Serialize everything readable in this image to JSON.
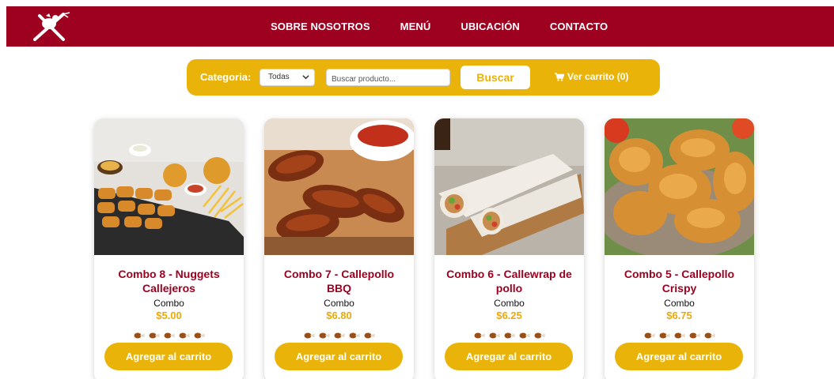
{
  "colors": {
    "brand": "#9e0020",
    "accent": "#e9b30a",
    "price": "#e9a90a"
  },
  "navbar": {
    "logo_icon": "chicken-fork-knife-logo-icon",
    "links": [
      "SOBRE NOSOTROS",
      "MENÚ",
      "UBICACIÓN",
      "CONTACTO"
    ]
  },
  "filters": {
    "category_label": "Categoria:",
    "category_selected": "Todas",
    "search_placeholder": "Buscar producto...",
    "search_button": "Buscar",
    "cart_icon": "cart-icon",
    "cart_label": "Ver carrito (0)"
  },
  "products": [
    {
      "title": "Combo 8 - Nuggets Callejeros",
      "category": "Combo",
      "price": "$5.00",
      "rating": 5,
      "button": "Agregar al carrito"
    },
    {
      "title": "Combo 7 - Callepollo BBQ",
      "category": "Combo",
      "price": "$6.80",
      "rating": 5,
      "button": "Agregar al carrito"
    },
    {
      "title": "Combo 6 - Callewrap de pollo",
      "category": "Combo",
      "price": "$6.25",
      "rating": 5,
      "button": "Agregar al carrito"
    },
    {
      "title": "Combo 5 - Callepollo Crispy",
      "category": "Combo",
      "price": "$6.75",
      "rating": 5,
      "button": "Agregar al carrito"
    }
  ]
}
